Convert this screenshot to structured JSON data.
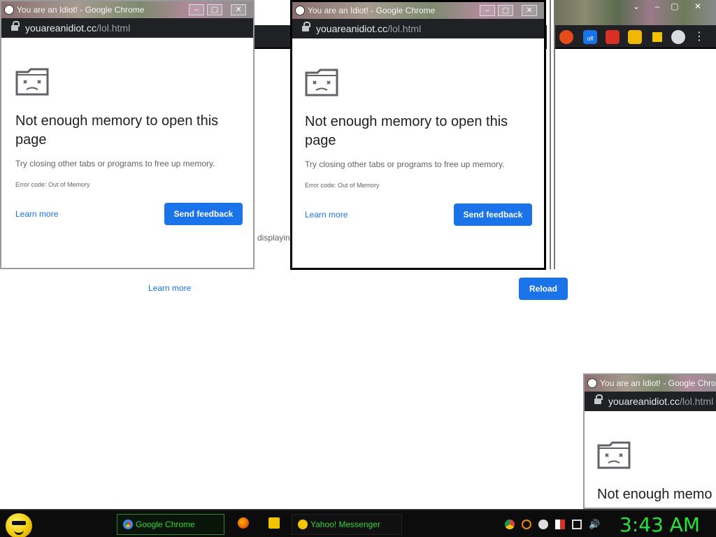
{
  "windows": [
    {
      "title": "You are an Idiot! - Google Chrome",
      "url_host": "youareanidiot.cc",
      "url_path": "/lol.html",
      "error_title": "Not enough memory to open this page",
      "error_desc": "Try closing other tabs or programs to free up memory.",
      "error_code": "Error code: Out of Memory",
      "learn_more": "Learn more",
      "send_feedback": "Send feedback"
    },
    {
      "title": "You are an Idiot! - Google Chrome",
      "url_host": "youareanidiot.cc",
      "url_path": "/lol.html",
      "error_title": "Not enough memory to open this page",
      "error_desc": "Try closing other tabs or programs to free up memory.",
      "error_code": "Error code: Out of Memory",
      "learn_more": "Learn more",
      "send_feedback": "Send feedback"
    },
    {
      "title": "You are an Idiot! - Google Chro",
      "url_host": "youareanidiot.cc",
      "url_path": "/lol.html",
      "error_title": "Not enough memo"
    }
  ],
  "background_page": {
    "partial_text": "e displayin",
    "learn_more": "Learn more",
    "reload": "Reload",
    "toolbar_badge": "off"
  },
  "taskbar": {
    "buttons": [
      {
        "label": "Google Chrome",
        "icon": "chrome-icon"
      },
      {
        "label": "Yahoo! Messenger",
        "icon": "yahoo-messenger-icon"
      }
    ],
    "quick_launch": [
      "firefox-icon",
      "folder-icon"
    ],
    "tray_icons": [
      "chrome-icon",
      "search-icon",
      "messenger-icon",
      "flag-icon",
      "network-icon",
      "volume-icon"
    ],
    "clock": "3:43 AM"
  },
  "colors": {
    "accent_blue": "#1a73e8",
    "address_bar": "#202124",
    "taskbar_green": "#27e33b"
  }
}
